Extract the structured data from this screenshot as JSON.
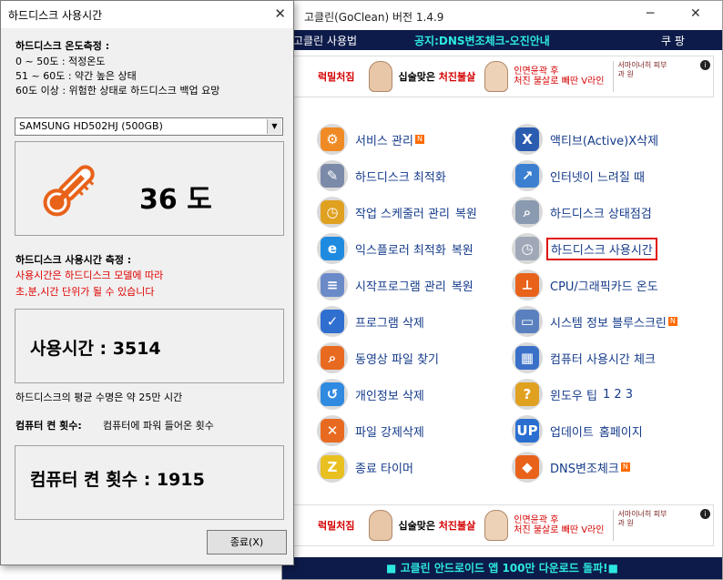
{
  "main": {
    "title": "고클린(GoClean) 버전 1.4.9",
    "menubar": {
      "left": "고클린 사용법",
      "notice": "공지:DNS변조체크-오진안내",
      "right": "쿠 팡"
    },
    "banner": {
      "t1": "럭밀처짐",
      "t2a": "십술맞은 ",
      "t2b": "처진불살",
      "t3a": "인면윤곽 후",
      "t3b": "처진 불살로 빼딴 V라인",
      "logo": "서마이너히 피부과 원",
      "i": "i"
    },
    "items": [
      {
        "label": "서비스 관리",
        "badge": "N",
        "icon": "gear-icon"
      },
      {
        "label": "액티브(Active)X삭제",
        "badge": "",
        "icon": "activex-icon"
      },
      {
        "label": "하드디스크 최적화",
        "badge": "",
        "extra": "",
        "icon": "wrench-icon"
      },
      {
        "label": "인터넷이 느려질 때",
        "badge": "",
        "icon": "internet-speed-icon"
      },
      {
        "label": "작업 스케줄러 관리",
        "extra": "복원",
        "icon": "scheduler-icon"
      },
      {
        "label": "하드디스크 상태점검",
        "icon": "disk-check-icon"
      },
      {
        "label": "익스플로러 최적화",
        "extra": "복원",
        "icon": "explorer-icon"
      },
      {
        "label": "하드디스크 사용시간",
        "icon": "disk-clock-icon"
      },
      {
        "label": "시작프로그램 관리",
        "extra": "복원",
        "icon": "document-icon"
      },
      {
        "label": "CPU/그래픽카드 온도",
        "icon": "temperature-icon"
      },
      {
        "label": "프로그램 삭제",
        "icon": "checkmark-icon"
      },
      {
        "label": "시스템 정보 블루스크린",
        "badge": "N",
        "icon": "computer-icon"
      },
      {
        "label": "동영상 파일 찾기",
        "icon": "magnifier-icon"
      },
      {
        "label": "컴퓨터 사용시간 체크",
        "icon": "calendar-icon"
      },
      {
        "label": "개인정보 삭제",
        "icon": "privacy-icon"
      },
      {
        "label": "윈도우 팁",
        "extra": "1   2   3",
        "icon": "tip-icon"
      },
      {
        "label": "파일 강제삭제",
        "icon": "delete-icon"
      },
      {
        "label": "업데이트",
        "extra": "홈페이지",
        "icon": "update-icon"
      },
      {
        "label": "종료 타이머",
        "icon": "sleep-icon"
      },
      {
        "label": "DNS변조체크",
        "badge": "N",
        "icon": "shield-icon"
      }
    ],
    "bottom": "■ 고클린 안드로이드 앱 100만 다운로드 돌파!■"
  },
  "dialog": {
    "title": "하드디스크 사용시간",
    "close": "✕",
    "temp_heading": "하드디스크 온도측정 :",
    "temp_lines": [
      "0  ~ 50도 : 적정온도",
      "51 ~ 60도 : 약간 높은 상태",
      "60도 이상 : 위험한 상태로 하드디스크 백업 요망"
    ],
    "disk_select": "SAMSUNG HD502HJ (500GB)",
    "temperature": "36 도",
    "usage_heading": "하드디스크 사용시간 측정 :",
    "usage_note1": "사용시간은 하드디스크 모델에 따라",
    "usage_note2": "초,분,시간 단위가 될 수 있습니다",
    "usage_value": "사용시간 : 3514",
    "lifespan": "하드디스크의 평균 수명은 약 25만 시간",
    "power_label": "컴퓨터 켠 횟수:",
    "power_desc": "컴퓨터에 파워 들어온 횟수",
    "power_value": "컴퓨터 켠 횟수 : 1915",
    "close_button": "종료(X)"
  }
}
